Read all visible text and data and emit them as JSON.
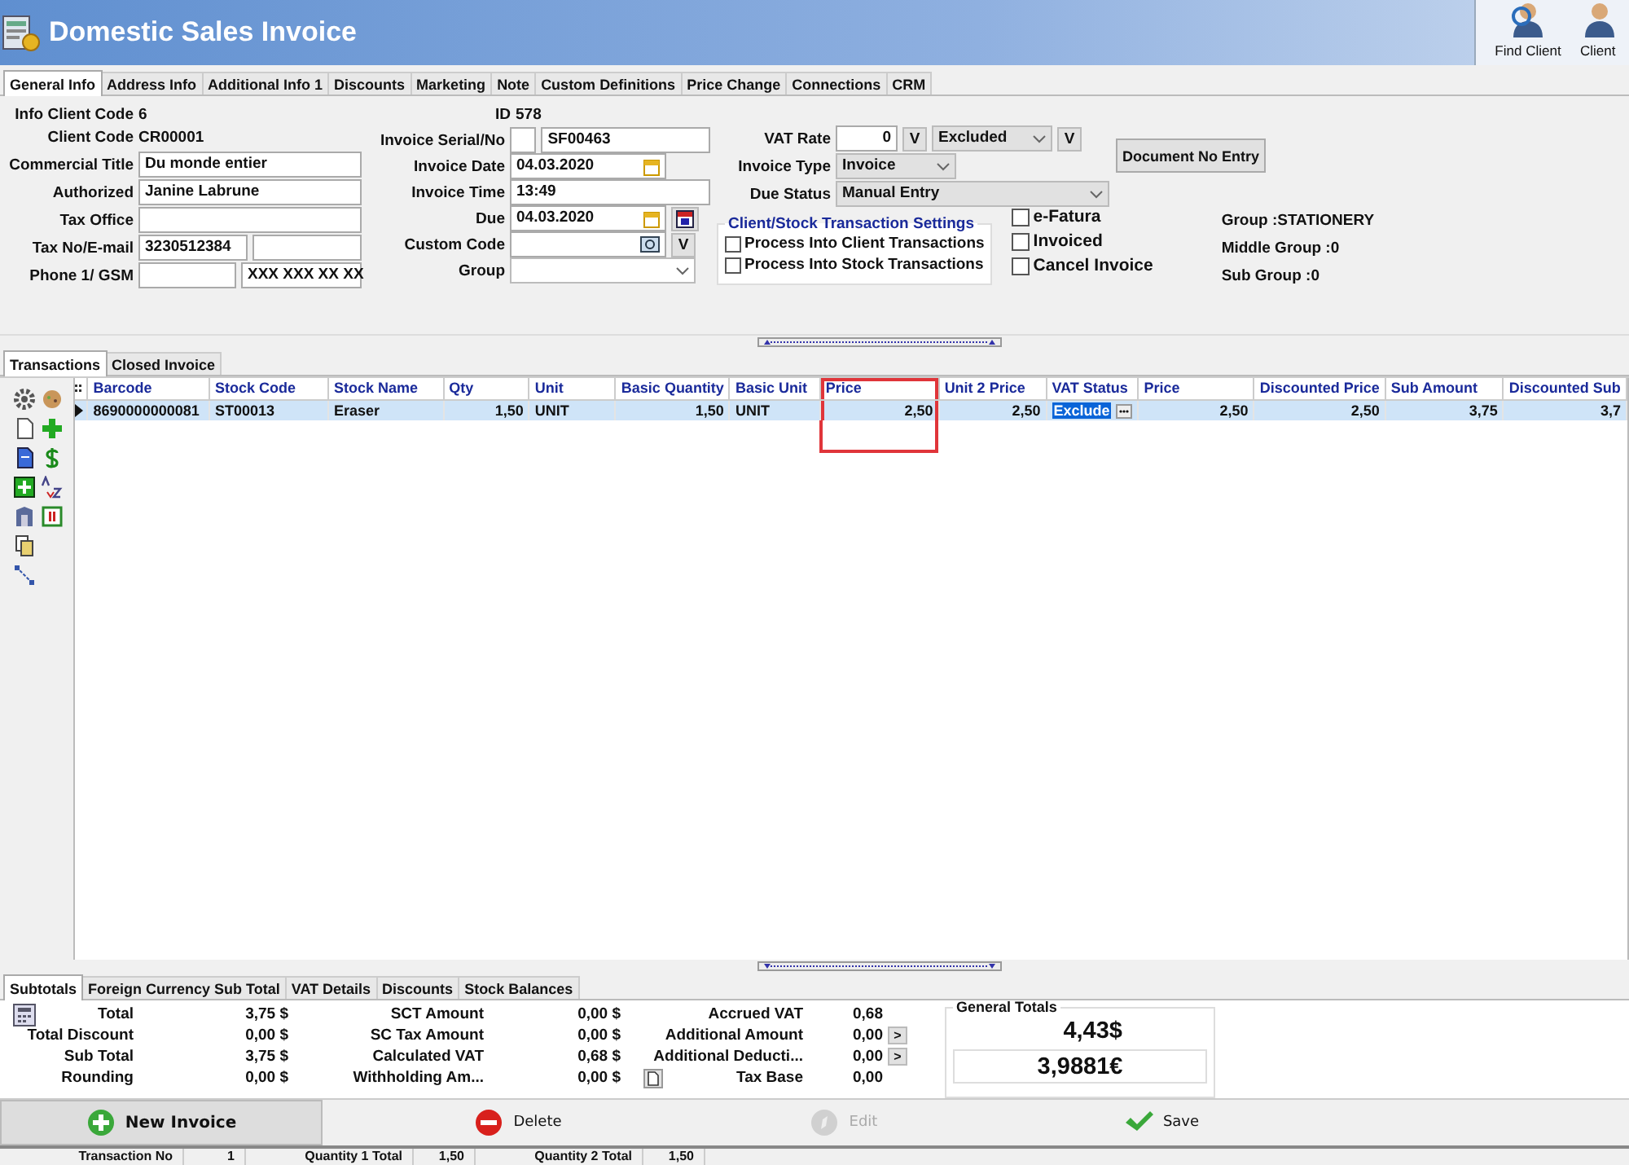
{
  "window": {
    "title": "Domestic Sales Invoice"
  },
  "toolbar": [
    {
      "label": "Find Client"
    },
    {
      "label": "Client"
    }
  ],
  "tabs": [
    {
      "label": "General Info",
      "selected": true
    },
    {
      "label": "Address Info",
      "selected": false
    },
    {
      "label": "Additional Info 1",
      "selected": false
    },
    {
      "label": "Discounts",
      "selected": false
    },
    {
      "label": "Marketing",
      "selected": false
    },
    {
      "label": "Note",
      "selected": false
    },
    {
      "label": "Custom Definitions",
      "selected": false
    },
    {
      "label": "Price Change",
      "selected": false
    },
    {
      "label": "Connections",
      "selected": false
    },
    {
      "label": "CRM",
      "selected": false
    }
  ],
  "form": {
    "info": [
      {
        "label": "Info Client Code",
        "value": "6"
      },
      {
        "label": "Client Code",
        "value": "CR00001"
      }
    ],
    "client_fields": [
      {
        "label": "Commercial Title",
        "inputs": [
          {
            "kind": "text",
            "value": "Du monde entier"
          }
        ]
      },
      {
        "label": "Authorized",
        "inputs": [
          {
            "kind": "text",
            "value": "Janine Labrune"
          }
        ]
      },
      {
        "label": "Tax Office",
        "inputs": [
          {
            "kind": "text"
          }
        ]
      },
      {
        "label": "Tax No/E-mail",
        "inputs": [
          {
            "kind": "half",
            "value": "3230512384"
          },
          {
            "kind": "half"
          }
        ]
      },
      {
        "label": "Phone 1/ GSM",
        "inputs": [
          {
            "kind": "half"
          },
          {
            "kind": "half",
            "value": "XXX XXX XX XX"
          }
        ]
      }
    ],
    "id": {
      "label": "ID",
      "value": "578"
    },
    "invoice_fields": [
      {
        "label": "Invoice Serial/No",
        "inputs": [
          {
            "kind": "short"
          },
          {
            "kind": "text",
            "value": "SF00463"
          }
        ]
      },
      {
        "label": "Invoice Date",
        "inputs": [
          {
            "kind": "date",
            "value": "04.03.2020"
          }
        ]
      },
      {
        "label": "Invoice Time",
        "inputs": [
          {
            "kind": "text",
            "value": "13:49"
          }
        ]
      },
      {
        "label": "Due",
        "inputs": [
          {
            "kind": "date",
            "value": "04.03.2020"
          },
          {
            "kind": "calendar"
          }
        ]
      },
      {
        "label": "Custom Code",
        "inputs": [
          {
            "kind": "search"
          },
          {
            "kind": "button",
            "label": "V"
          }
        ]
      },
      {
        "label": "Group",
        "inputs": [
          {
            "kind": "combo"
          }
        ]
      }
    ],
    "vat_fields": [
      {
        "label": "VAT Rate",
        "inputs": [
          {
            "kind": "number",
            "value": "0"
          },
          {
            "kind": "button",
            "label": "V"
          },
          {
            "kind": "combo",
            "value": "Excluded"
          },
          {
            "kind": "button",
            "label": "V"
          }
        ]
      },
      {
        "label": "Invoice Type",
        "inputs": [
          {
            "kind": "combo",
            "value": "Invoice"
          }
        ]
      },
      {
        "label": "Due Status",
        "inputs": [
          {
            "kind": "wide-combo",
            "value": "Manual Entry"
          }
        ]
      }
    ],
    "document_button": "Document No Entry",
    "settings": {
      "title": "Client/Stock Transaction Settings",
      "options": [
        {
          "label": "Process Into Client Transactions",
          "checked": false
        },
        {
          "label": "Process Into Stock Transactions",
          "checked": false
        }
      ]
    },
    "flags": [
      {
        "label": "e-Fatura",
        "checked": false
      },
      {
        "label": "Invoiced",
        "checked": false
      },
      {
        "label": "Cancel Invoice",
        "checked": false
      }
    ],
    "groups": [
      "Group :STATIONERY",
      "Middle Group :0",
      "Sub Group :0"
    ]
  },
  "transactions": {
    "tabs": [
      {
        "label": "Transactions",
        "selected": true
      },
      {
        "label": "Closed Invoice",
        "selected": false
      }
    ],
    "columns": [
      {
        "label": "Barcode",
        "kind": "text",
        "highlighted": false
      },
      {
        "label": "Stock Code",
        "kind": "text",
        "highlighted": false
      },
      {
        "label": "Stock Name",
        "kind": "text",
        "highlighted": false
      },
      {
        "label": "Qty",
        "kind": "number",
        "highlighted": false
      },
      {
        "label": "Unit",
        "kind": "text",
        "highlighted": false
      },
      {
        "label": "Basic Quantity",
        "kind": "number",
        "highlighted": false
      },
      {
        "label": "Basic Unit",
        "kind": "text",
        "highlighted": false
      },
      {
        "label": "Price",
        "kind": "number",
        "highlighted": true
      },
      {
        "label": "Unit 2 Price",
        "kind": "number",
        "highlighted": false
      },
      {
        "label": "VAT Status",
        "kind": "status",
        "highlighted": false
      },
      {
        "label": "Price",
        "kind": "number",
        "highlighted": false
      },
      {
        "label": "Discounted Price",
        "kind": "number",
        "highlighted": false
      },
      {
        "label": "Sub Amount",
        "kind": "number",
        "highlighted": false
      },
      {
        "label": "Discounted Sub",
        "kind": "number",
        "highlighted": false
      }
    ],
    "rows": [
      {
        "selected": true,
        "cells": [
          "8690000000081",
          "ST00013",
          "Eraser",
          "1,50",
          "UNIT",
          "1,50",
          "UNIT",
          "2,50",
          "2,50",
          "Exclude",
          "2,50",
          "2,50",
          "3,75",
          "3,7"
        ]
      }
    ]
  },
  "totals": {
    "tabs": [
      {
        "label": "Subtotals",
        "selected": true
      },
      {
        "label": "Foreign Currency Sub Total",
        "selected": false
      },
      {
        "label": "VAT Details",
        "selected": false
      },
      {
        "label": "Discounts",
        "selected": false
      },
      {
        "label": "Stock Balances",
        "selected": false
      }
    ],
    "rows": [
      [
        {
          "label": "Total",
          "value": "3,75 $"
        },
        {
          "label": "SCT Amount",
          "value": "0,00 $"
        },
        {
          "label": "Accrued VAT",
          "value": "0,68"
        }
      ],
      [
        {
          "label": "Total Discount",
          "value": "0,00 $"
        },
        {
          "label": "SC Tax Amount",
          "value": "0,00 $"
        },
        {
          "label": "Additional Amount",
          "value": "0,00",
          "button": ">"
        }
      ],
      [
        {
          "label": "Sub Total",
          "value": "3,75 $"
        },
        {
          "label": "Calculated VAT",
          "value": "0,68 $"
        },
        {
          "label": "Additional Deducti...",
          "value": "0,00",
          "button": ">"
        }
      ],
      [
        {
          "label": "Rounding",
          "value": "0,00 $"
        },
        {
          "label": "Withholding Am...",
          "value": "0,00 $"
        },
        {
          "label": "Tax Base",
          "value": "0,00"
        }
      ]
    ],
    "general_totals": {
      "title": "General Totals",
      "values": [
        "4,43$",
        "3,9881€"
      ]
    }
  },
  "actions": [
    {
      "label": "New Invoice",
      "kind": "new",
      "disabled": false
    },
    {
      "label": "Delete",
      "kind": "delete",
      "disabled": false
    },
    {
      "label": "Edit",
      "kind": "edit",
      "disabled": true
    },
    {
      "label": "Save",
      "kind": "save",
      "disabled": false
    }
  ],
  "status": [
    "Transaction No",
    "1",
    "Quantity 1 Total",
    "1,50",
    "Quantity 2 Total",
    "1,50"
  ]
}
